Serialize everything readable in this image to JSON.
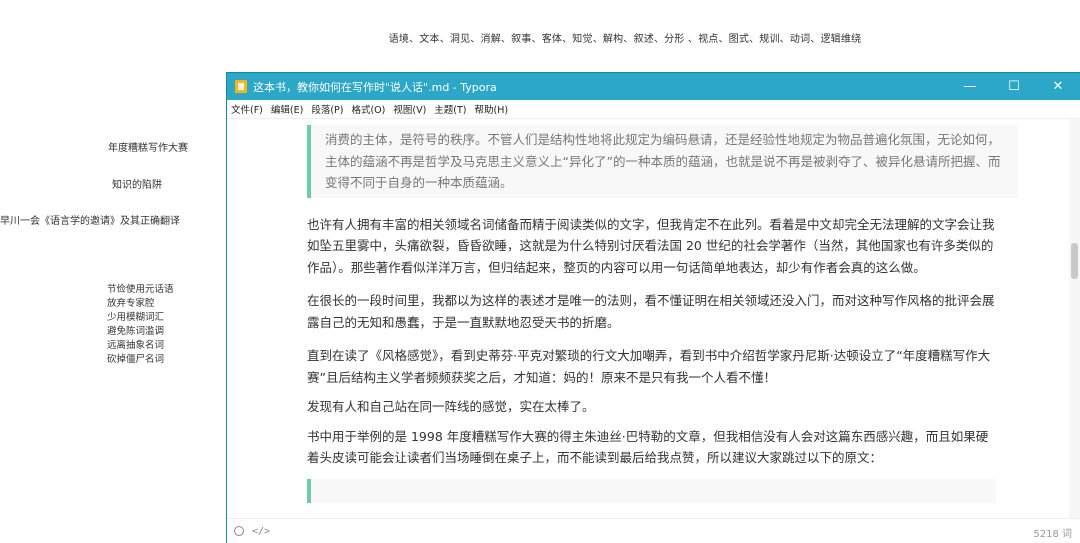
{
  "top_caption": "语境、文本、洞见、消解、叙事、客体、知觉、解构、叙述、分形 、视点、图式、规训、动词、逻辑维绕",
  "side": {
    "label1": "年度糟糕写作大赛",
    "label2": "知识的陷阱",
    "label3": "早川一会《语言学的邀请》及其正确翻译",
    "list": [
      "节俭使用元话语",
      "放弃专家腔",
      "少用模糊词汇",
      "避免陈词滥调",
      "远离抽象名词",
      "砍掉僵尸名词"
    ]
  },
  "window": {
    "title": "这本书，教你如何在写作时\"说人话\".md - Typora",
    "minimize": "—",
    "maximize": "☐",
    "close": "✕",
    "menu": [
      "文件(F)",
      "编辑(E)",
      "段落(P)",
      "格式(O)",
      "视图(V)",
      "主题(T)",
      "帮助(H)"
    ]
  },
  "doc": {
    "quote": "消费的主体，是符号的秩序。不管人们是结构性地将此规定为编码悬请，还是经验性地规定为物品普遍化氛围，无论如何，主体的蕴涵不再是哲学及马克思主义意义上“异化了”的一种本质的蕴涵，也就是说不再是被剥夺了、被异化悬请所把握、而变得不同于自身的一种本质蕴涵。",
    "p1": "也许有人拥有丰富的相关领域名词储备而精于阅读类似的文字，但我肯定不在此列。看着是中文却完全无法理解的文字会让我如坠五里雾中，头痛欲裂，昏昏欲睡，这就是为什么特别讨厌看法国 20 世纪的社会学著作（当然，其他国家也有许多类似的作品）。那些著作看似洋洋万言，但归结起来，整页的内容可以用一句话简单地表达，却少有作者会真的这么做。",
    "p2": "在很长的一段时间里，我都以为这样的表述才是唯一的法则，看不懂证明在相关领域还没入门，而对这种写作风格的批评会展露自己的无知和愚蠢，于是一直默默地忍受天书的折磨。",
    "p3": "直到在读了《风格感觉》，看到史蒂芬·平克对繁琐的行文大加嘲弄，看到书中介绍哲学家丹尼斯·达顿设立了“年度糟糕写作大赛”且后结构主义学者频频获奖之后，才知道：妈的！原来不是只有我一个人看不懂！",
    "p4": "发现有人和自己站在同一阵线的感觉，实在太棒了。",
    "p5": "书中用于举例的是 1998 年度糟糕写作大赛的得主朱迪丝·巴特勒的文章，但我相信没有人会对这篇东西感兴趣，而且如果硬着头皮读可能会让读者们当场睡倒在桌子上，而不能读到最后给我点赞，所以建议大家跳过以下的原文："
  },
  "status": {
    "code_toggle": "</>",
    "word_count": "5218 词"
  }
}
